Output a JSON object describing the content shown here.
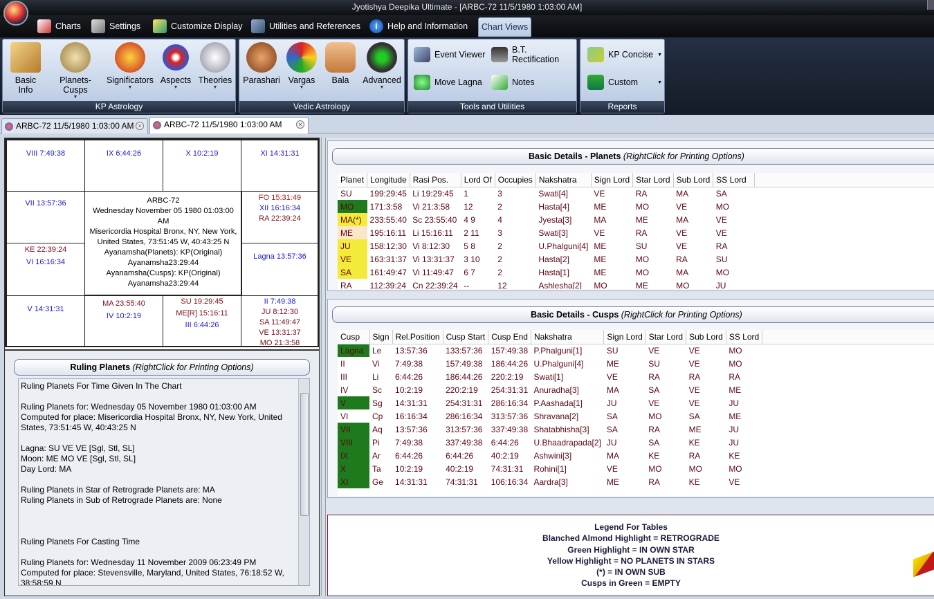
{
  "window": {
    "title": "Jyotishya Deepika Ultimate - [ARBC-72 11/5/1980 1:03:00 AM]"
  },
  "menu": {
    "charts": "Charts",
    "settings": "Settings",
    "customize": "Customize Display",
    "utilities": "Utilities and References",
    "help": "Help and Information",
    "chartviews": "Chart Views"
  },
  "ribbon": {
    "kp": {
      "label": "KP Astrology",
      "basic": "Basic Info",
      "planets": "Planets-Cusps",
      "signif": "Significators",
      "aspects": "Aspects",
      "theories": "Theories"
    },
    "vedic": {
      "label": "Vedic Astrology",
      "parashari": "Parashari",
      "vargas": "Vargas",
      "bala": "Bala",
      "advanced": "Advanced"
    },
    "tools": {
      "label": "Tools and Utilities",
      "event": "Event Viewer",
      "bt": "B.T. Rectification",
      "move": "Move Lagna",
      "notes": "Notes"
    },
    "reports": {
      "label": "Reports",
      "kp": "KP Concise",
      "custom": "Custom"
    }
  },
  "doctabs": [
    "ARBC-72 11/5/1980 1:03:00 AM",
    "ARBC-72  11/5/1980 1:03:00 AM"
  ],
  "chart": {
    "c8": "VIII 7:49:38",
    "c9": "IX 6:44:26",
    "c10": "X 10:2:19",
    "c11": "XI 14:31:31",
    "c7": "VII 13:57:36",
    "c12a": "FO 15:31:49",
    "c12b": "XII 16:16:34",
    "c12c": "RA 22:39:24",
    "c6a": "KE 22:39:24",
    "c6b": "VI 16:16:34",
    "c1": "Lagna 13:57:36",
    "c5": "V 14:31:31",
    "c4a": "MA 23:55:40",
    "c4b": "IV 10:2:19",
    "c3a": "SU 19:29:45",
    "c3b": "ME[R] 15:16:11",
    "c3c": "III 6:44:26",
    "c2a": "II 7:49:38",
    "c2b": "JU 8:12:30",
    "c2c": "SA 11:49:47",
    "c2d": "VE 13:31:37",
    "c2e": "MO 21:3:58",
    "center": {
      "name": "ARBC-72",
      "date": "Wednesday November 05 1980  01:03:00",
      "ampm": "AM",
      "place1": "Misericordia Hospital Bronx, NY, New York,",
      "place2": "United States, 73:51:45 W, 40:43:25 N",
      "ay1": "Ayanamsha(Planets): KP(Original)",
      "ay2": "Ayanamsha23:29:44",
      "ay3": "Ayanamsha(Cusps): KP(Original)",
      "ay4": "Ayanamsha23:29:44"
    }
  },
  "ruling": {
    "title": "Ruling  Planets ",
    "hint": "(RightClick for Printing Options)",
    "text": "Ruling Planets For Time Given In The Chart\n\nRuling Planets for: Wednesday 05 November 1980 01:03:00 AM\nComputed for place: Misericordia Hospital Bronx, NY, New York, United States, 73:51:45 W, 40:43:25 N\n\nLagna: SU VE VE [Sgl, Stl, SL]\nMoon: ME MO VE [Sgl, Stl, SL]\nDay Lord: MA\n\nRuling Planets in Star of Retrograde Planets are: MA\nRuling Planets in Sub of Retrograde Planets are: None\n\n\n\nRuling Planets For Casting Time\n\nRuling Planets for: Wednesday 11 November 2009 06:23:49 PM\nComputed for place: Stevensville, Maryland, United States, 76:18:52 W,\n38:58:59 N"
  },
  "planets": {
    "title": "Basic  Details  -  Planets ",
    "hint": "(RightClick for Printing Options)",
    "headers": [
      "Planet",
      "Longitude",
      "Rasi Pos.",
      "Lord Of",
      "Occupies",
      "Nakshatra",
      "Sign Lord",
      "Star Lord",
      "Sub Lord",
      "SS Lord"
    ],
    "rows": [
      [
        "SU",
        "199:29:45",
        "Li  19:29:45",
        "1",
        "3",
        "Swati[4]",
        "VE",
        "RA",
        "MA",
        "SA"
      ],
      [
        "MO",
        "171:3:58",
        "Vi  21:3:58",
        "12",
        "2",
        "Hasta[4]",
        "ME",
        "MO",
        "VE",
        "MO"
      ],
      [
        "MA(*)",
        "233:55:40",
        "Sc  23:55:40",
        "4   9",
        "4",
        "Jyesta[3]",
        "MA",
        "ME",
        "MA",
        "VE"
      ],
      [
        "ME",
        "195:16:11",
        "Li  15:16:11",
        "2   11",
        "3",
        "Swati[3]",
        "VE",
        "RA",
        "VE",
        "VE"
      ],
      [
        "JU",
        "158:12:30",
        "Vi  8:12:30",
        "5   8",
        "2",
        "U.Phalguni[4]",
        "ME",
        "SU",
        "VE",
        "RA"
      ],
      [
        "VE",
        "163:31:37",
        "Vi  13:31:37",
        "3   10",
        "2",
        "Hasta[2]",
        "ME",
        "MO",
        "RA",
        "SU"
      ],
      [
        "SA",
        "161:49:47",
        "Vi  11:49:47",
        "6   7",
        "2",
        "Hasta[1]",
        "ME",
        "MO",
        "MA",
        "MO"
      ],
      [
        "RA",
        "112:39:24",
        "Cn  22:39:24",
        "--",
        "12",
        "Ashlesha[2]",
        "MO",
        "ME",
        "MO",
        "JU"
      ]
    ],
    "highlights": [
      "",
      "#1d7a1d",
      "#f4ea3a",
      "#fbe7c8",
      "#f4ea3a",
      "#f4ea3a",
      "#f4ea3a",
      ""
    ]
  },
  "cusps": {
    "title": "Basic  Details  -  Cusps ",
    "hint": "(RightClick for Printing Options)",
    "headers": [
      "Cusp",
      "Sign",
      "Rel.Position",
      "Cusp Start",
      "Cusp End",
      "Nakshatra",
      "Sign Lord",
      "Star Lord",
      "Sub Lord",
      "SS Lord"
    ],
    "rows": [
      [
        "Lagna",
        "Le",
        "13:57:36",
        "133:57:36",
        "157:49:38",
        "P.Phalguni[1]",
        "SU",
        "VE",
        "VE",
        "MO"
      ],
      [
        "II",
        "Vi",
        "7:49:38",
        "157:49:38",
        "186:44:26",
        "U.Phalguni[4]",
        "ME",
        "SU",
        "VE",
        "MO"
      ],
      [
        "III",
        "Li",
        "6:44:26",
        "186:44:26",
        "220:2:19",
        "Swati[1]",
        "VE",
        "RA",
        "RA",
        "RA"
      ],
      [
        "IV",
        "Sc",
        "10:2:19",
        "220:2:19",
        "254:31:31",
        "Anuradha[3]",
        "MA",
        "SA",
        "VE",
        "ME"
      ],
      [
        "V",
        "Sg",
        "14:31:31",
        "254:31:31",
        "286:16:34",
        "P.Aashada[1]",
        "JU",
        "VE",
        "VE",
        "JU"
      ],
      [
        "VI",
        "Cp",
        "16:16:34",
        "286:16:34",
        "313:57:36",
        "Shravana[2]",
        "SA",
        "MO",
        "SA",
        "ME"
      ],
      [
        "VII",
        "Aq",
        "13:57:36",
        "313:57:36",
        "337:49:38",
        "Shatabhisha[3]",
        "SA",
        "RA",
        "ME",
        "JU"
      ],
      [
        "VIII",
        "Pi",
        "7:49:38",
        "337:49:38",
        "6:44:26",
        "U.Bhaadrapada[2]",
        "JU",
        "SA",
        "KE",
        "JU"
      ],
      [
        "IX",
        "Ar",
        "6:44:26",
        "6:44:26",
        "40:2:19",
        "Ashwini[3]",
        "MA",
        "KE",
        "RA",
        "KE"
      ],
      [
        "X",
        "Ta",
        "10:2:19",
        "40:2:19",
        "74:31:31",
        "Rohini[1]",
        "VE",
        "MO",
        "MO",
        "MO"
      ],
      [
        "XI",
        "Ge",
        "14:31:31",
        "74:31:31",
        "106:16:34",
        "Aardra[3]",
        "ME",
        "RA",
        "KE",
        "VE"
      ]
    ],
    "highlights": [
      "#1d7a1d",
      "",
      "",
      "",
      "#1d7a1d",
      "",
      "#1d7a1d",
      "#1d7a1d",
      "#1d7a1d",
      "#1d7a1d",
      "#1d7a1d"
    ]
  },
  "legend": [
    "Legend For Tables",
    "Blanched Almond Highlight = RETROGRADE",
    "Green Highlight = IN OWN STAR",
    "Yellow Highlight = NO PLANETS IN STARS",
    "(*) = IN OWN SUB",
    "Cusps in Green = EMPTY"
  ]
}
